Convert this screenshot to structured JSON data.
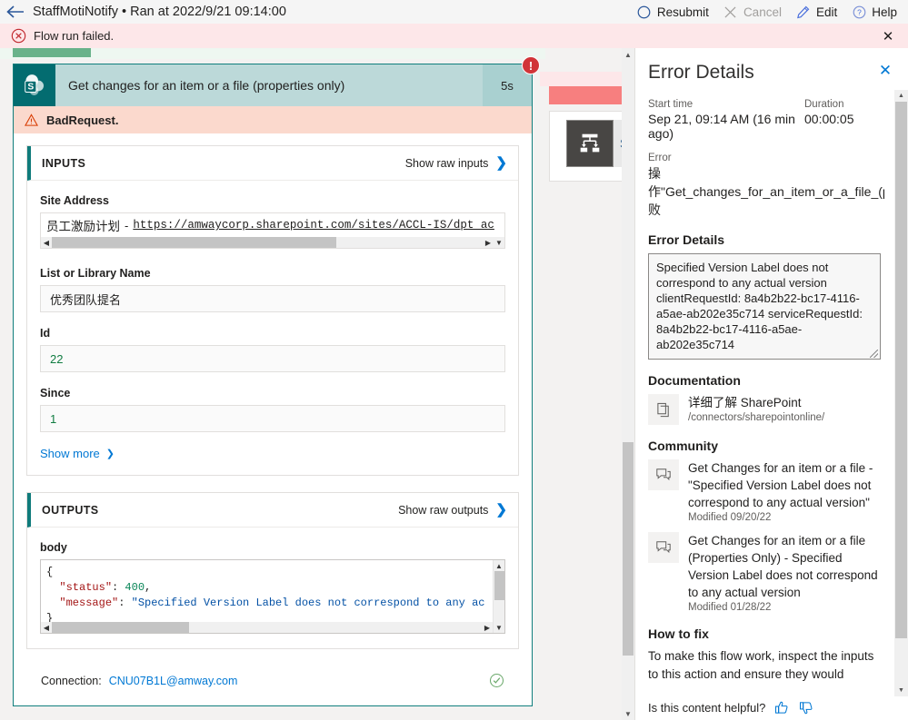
{
  "topbar": {
    "back_icon": "back-arrow-icon",
    "run_title": "StaffMotiNotify • Ran at 2022/9/21 09:14:00",
    "commands": [
      {
        "label": "Resubmit",
        "icon": "resubmit-circle-icon",
        "disabled": false
      },
      {
        "label": "Cancel",
        "icon": "cancel-x-icon",
        "disabled": true
      },
      {
        "label": "Edit",
        "icon": "edit-pencil-icon",
        "disabled": false
      },
      {
        "label": "Help",
        "icon": "help-question-icon",
        "disabled": false
      }
    ]
  },
  "banner": {
    "icon": "error-circle-x-icon",
    "text": "Flow run failed.",
    "close_label": "✕"
  },
  "action_card": {
    "connector_icon": "sharepoint-icon",
    "title": "Get changes for an item or a file (properties only)",
    "duration": "5s",
    "error_badge": "!",
    "status_icon": "warning-triangle-icon",
    "status_text": "BadRequest.",
    "inputs": {
      "section_label": "INPUTS",
      "raw_link": "Show raw inputs",
      "fields": [
        {
          "label": "Site Address",
          "value_cn": "员工激励计划",
          "value_dash": "-",
          "value_url": "https://amwaycorp.sharepoint.com/sites/ACCL-IS/dpt_ac",
          "scrollable": true
        },
        {
          "label": "List or Library Name",
          "value": "优秀团队提名",
          "numeric": false
        },
        {
          "label": "Id",
          "value": "22",
          "numeric": true
        },
        {
          "label": "Since",
          "value": "1",
          "numeric": true
        }
      ],
      "show_more": "Show more"
    },
    "outputs": {
      "section_label": "OUTPUTS",
      "raw_link": "Show raw outputs",
      "body_label": "body",
      "json_lines": [
        {
          "punct_open": "{"
        },
        {
          "key": "\"status\"",
          "colon": ": ",
          "num": "400",
          "comma": ","
        },
        {
          "key": "\"message\"",
          "colon": ": ",
          "str": "\"Specified Version Label does not correspond to any ac",
          "comma": ""
        },
        {
          "punct_close": "}"
        }
      ]
    },
    "connection": {
      "label": "Connection:",
      "value": "CNU07B1L@amway.com",
      "status_icon": "check-circle-icon"
    }
  },
  "background_card": {
    "title": "St",
    "icon": "parallel-branch-icon"
  },
  "flyout": {
    "title": "Error Details",
    "close_label": "✕",
    "start_time_label": "Start time",
    "start_time_value": "Sep 21, 09:14 AM (16 min ago)",
    "duration_label": "Duration",
    "duration_value": "00:00:05",
    "error_label": "Error",
    "error_lines": [
      "操",
      "作\"Get_changes_for_an_item_or_a_file_(propert",
      "败"
    ],
    "error_details_heading": "Error Details",
    "error_details_text": "Specified Version Label does not correspond to any actual version clientRequestId: 8a4b2b22-bc17-4116-a5ae-ab202e35c714 serviceRequestId: 8a4b2b22-bc17-4116-a5ae-ab202e35c714",
    "documentation_heading": "Documentation",
    "documentation_items": [
      {
        "icon": "pages-copy-icon",
        "title": "详细了解 SharePoint",
        "sub": "/connectors/sharepointonline/"
      }
    ],
    "community_heading": "Community",
    "community_items": [
      {
        "icon": "comment-chat-icon",
        "title": "Get Changes for an item or a file - \"Specified Version Label does not correspond to any actual version\"",
        "sub": "Modified 09/20/22"
      },
      {
        "icon": "comment-chat-icon",
        "title": "Get Changes for an item or a file (Properties Only) - Specified Version Label does not correspond to any actual version",
        "sub": "Modified 01/28/22"
      }
    ],
    "howto_heading": "How to fix",
    "howto_text": "To make this flow work, inspect the inputs to this action and ensure they would",
    "footer_text": "Is this content helpful?",
    "thumbs_up_icon": "thumbs-up-icon",
    "thumbs_down_icon": "thumbs-down-icon"
  },
  "colors": {
    "sharepoint_teal": "#036c70",
    "error_red": "#d13438",
    "accent_blue": "#0078d4",
    "banner_pink": "#fde7e9",
    "badrequest_peach": "#fbd9cd",
    "card_border_teal": "#107e7d"
  }
}
